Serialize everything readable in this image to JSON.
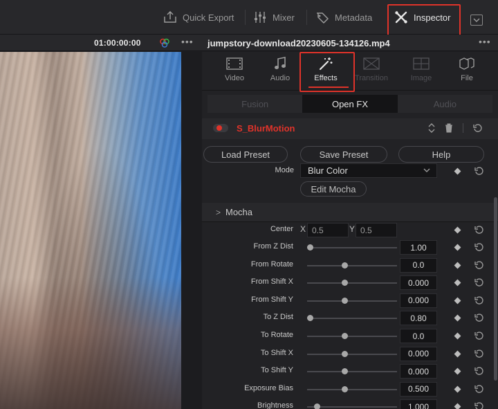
{
  "toolbar": {
    "quick_export": "Quick Export",
    "mixer": "Mixer",
    "metadata": "Metadata",
    "inspector": "Inspector",
    "accent": "#e0332a"
  },
  "viewer": {
    "timecode": "01:00:00:00"
  },
  "inspector": {
    "filename": "jumpstory-download20230605-134126.mp4",
    "tabs": [
      {
        "label": "Video",
        "icon": "film-icon"
      },
      {
        "label": "Audio",
        "icon": "music-note-icon"
      },
      {
        "label": "Effects",
        "icon": "magic-wand-icon"
      },
      {
        "label": "Transition",
        "icon": "transition-icon"
      },
      {
        "label": "Image",
        "icon": "image-icon"
      },
      {
        "label": "File",
        "icon": "file-icon"
      }
    ],
    "subtabs": [
      "Fusion",
      "Open FX",
      "Audio"
    ],
    "effect_name": "S_BlurMotion",
    "presets": {
      "load": "Load Preset",
      "save": "Save Preset",
      "help": "Help"
    },
    "mode": {
      "label": "Mode",
      "value": "Blur Color"
    },
    "edit_mocha": "Edit Mocha",
    "section_title": "Mocha",
    "center": {
      "label": "Center",
      "x_label": "X",
      "x_value": "0.5",
      "y_label": "Y",
      "y_value": "0.5"
    },
    "params": [
      {
        "label": "From Z Dist",
        "value": "1.00",
        "level": 0.0
      },
      {
        "label": "From Rotate",
        "value": "0.0",
        "level": 0.5
      },
      {
        "label": "From Shift X",
        "value": "0.000",
        "level": 0.5
      },
      {
        "label": "From Shift Y",
        "value": "0.000",
        "level": 0.5
      },
      {
        "label": "To Z Dist",
        "value": "0.80",
        "level": 0.0
      },
      {
        "label": "To Rotate",
        "value": "0.0",
        "level": 0.5
      },
      {
        "label": "To Shift X",
        "value": "0.000",
        "level": 0.5
      },
      {
        "label": "To Shift Y",
        "value": "0.000",
        "level": 0.5
      },
      {
        "label": "Exposure Bias",
        "value": "0.500",
        "level": 0.5
      },
      {
        "label": "Brightness",
        "value": "1.000",
        "level": 0.1
      }
    ]
  }
}
